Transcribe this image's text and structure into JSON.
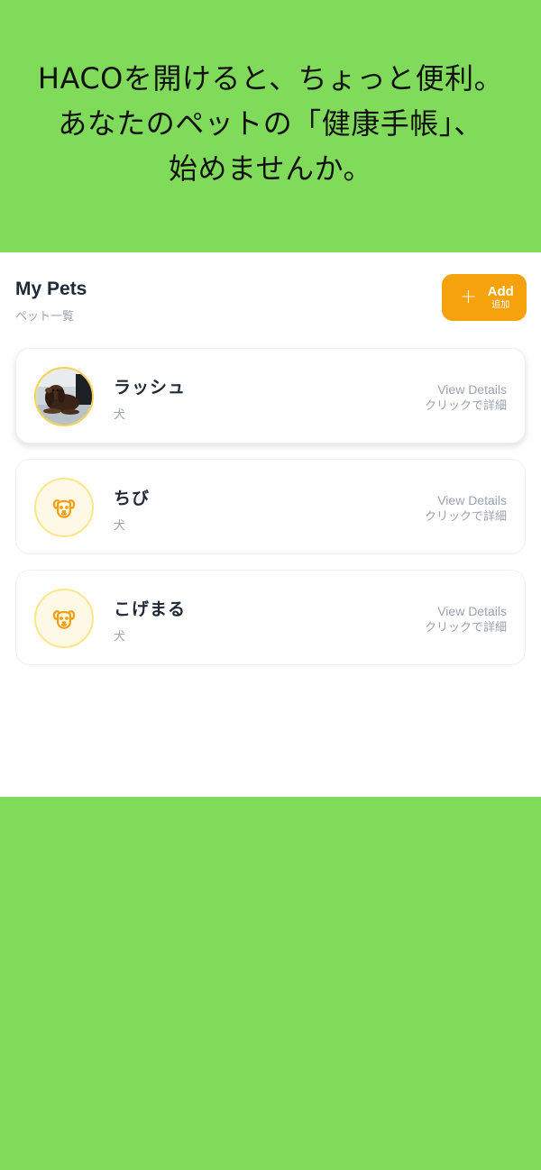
{
  "promo": {
    "lines": [
      "HACOを開けると、ちょっと便利。",
      "あなたのペットの「健康手帳」、",
      "始めませんか。"
    ]
  },
  "header": {
    "title": "My Pets",
    "subtitle": "ペット一覧",
    "add_label": "Add",
    "add_sub": "追加"
  },
  "pets": [
    {
      "name": "ラッシュ",
      "species": "犬",
      "avatar": "dog-photo",
      "detail_en": "View Details",
      "detail_ja": "クリックで詳細"
    },
    {
      "name": "ちび",
      "species": "犬",
      "avatar": "dog-icon",
      "detail_en": "View Details",
      "detail_ja": "クリックで詳細"
    },
    {
      "name": "こげまる",
      "species": "犬",
      "avatar": "dog-icon",
      "detail_en": "View Details",
      "detail_ja": "クリックで詳細"
    }
  ],
  "colors": {
    "background": "#7fdb59",
    "accent": "#f5a20c",
    "icon": "#f59e0b"
  }
}
